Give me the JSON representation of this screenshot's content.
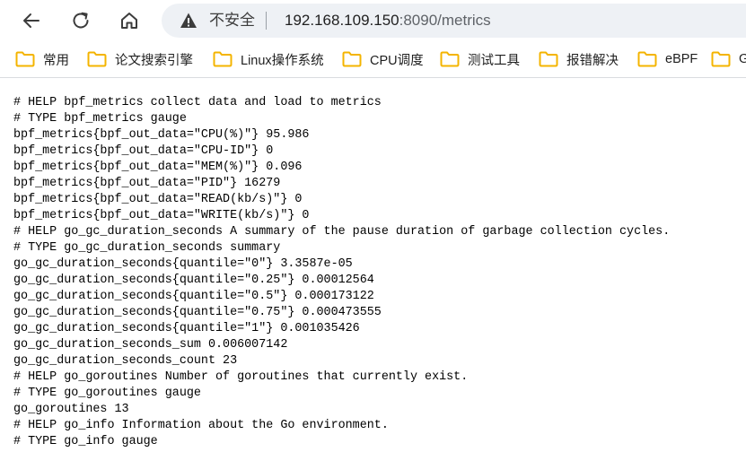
{
  "address_bar": {
    "security_label": "不安全",
    "url_host": "192.168.109.150",
    "url_rest": ":8090/metrics"
  },
  "bookmarks": [
    {
      "label": "常用"
    },
    {
      "label": "论文搜索引擎"
    },
    {
      "label": "Linux操作系统"
    },
    {
      "label": "CPU调度"
    },
    {
      "label": "测试工具"
    },
    {
      "label": "报错解决"
    },
    {
      "label": "eBPF"
    },
    {
      "label": "G"
    }
  ],
  "metrics_lines": [
    "# HELP bpf_metrics collect data and load to metrics",
    "# TYPE bpf_metrics gauge",
    "bpf_metrics{bpf_out_data=\"CPU(%)\"} 95.986",
    "bpf_metrics{bpf_out_data=\"CPU-ID\"} 0",
    "bpf_metrics{bpf_out_data=\"MEM(%)\"} 0.096",
    "bpf_metrics{bpf_out_data=\"PID\"} 16279",
    "bpf_metrics{bpf_out_data=\"READ(kb/s)\"} 0",
    "bpf_metrics{bpf_out_data=\"WRITE(kb/s)\"} 0",
    "# HELP go_gc_duration_seconds A summary of the pause duration of garbage collection cycles.",
    "# TYPE go_gc_duration_seconds summary",
    "go_gc_duration_seconds{quantile=\"0\"} 3.3587e-05",
    "go_gc_duration_seconds{quantile=\"0.25\"} 0.00012564",
    "go_gc_duration_seconds{quantile=\"0.5\"} 0.000173122",
    "go_gc_duration_seconds{quantile=\"0.75\"} 0.000473555",
    "go_gc_duration_seconds{quantile=\"1\"} 0.001035426",
    "go_gc_duration_seconds_sum 0.006007142",
    "go_gc_duration_seconds_count 23",
    "# HELP go_goroutines Number of goroutines that currently exist.",
    "# TYPE go_goroutines gauge",
    "go_goroutines 13",
    "# HELP go_info Information about the Go environment.",
    "# TYPE go_info gauge"
  ],
  "icons": {
    "back": "arrow-left-icon",
    "reload": "reload-icon",
    "home": "home-icon",
    "warning": "warning-triangle-icon",
    "folder": "folder-icon"
  },
  "colors": {
    "folder": "#f4b400",
    "omnibox_bg": "#eef1f5"
  }
}
